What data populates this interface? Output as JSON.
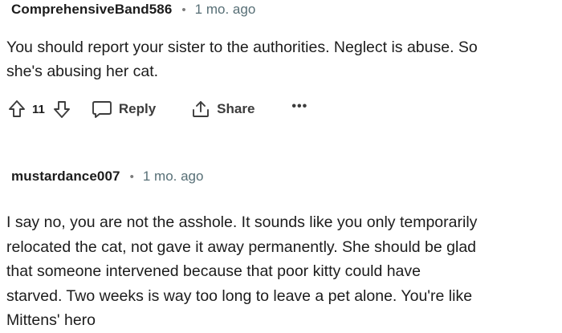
{
  "comments": [
    {
      "author": "ComprehensiveBand586",
      "separator": "•",
      "time": "1 mo. ago",
      "body_lines": [
        "You should report your sister to the authorities. Neglect is abuse. So",
        "she's abusing her cat."
      ],
      "score": "11",
      "reply_label": "Reply",
      "share_label": "Share",
      "more_label": "•••"
    },
    {
      "author": "mustardance007",
      "separator": "•",
      "time": "1 mo. ago",
      "body_lines": [
        "I say no, you are not the asshole. It sounds like you only temporarily",
        "relocated the cat, not gave it away permanently. She should be glad",
        "that someone intervened because that poor kitty could have",
        "starved. Two weeks is way too long to leave a pet alone. You're like",
        "Mittens' hero"
      ]
    }
  ],
  "icons": {
    "upvote": "upvote-arrow-icon",
    "downvote": "downvote-arrow-icon",
    "reply": "speech-bubble-icon",
    "share": "share-upload-icon"
  },
  "colors": {
    "text": "#1c1c1c",
    "meta": "#576f76",
    "action": "#3c3c3c",
    "background": "#ffffff"
  }
}
